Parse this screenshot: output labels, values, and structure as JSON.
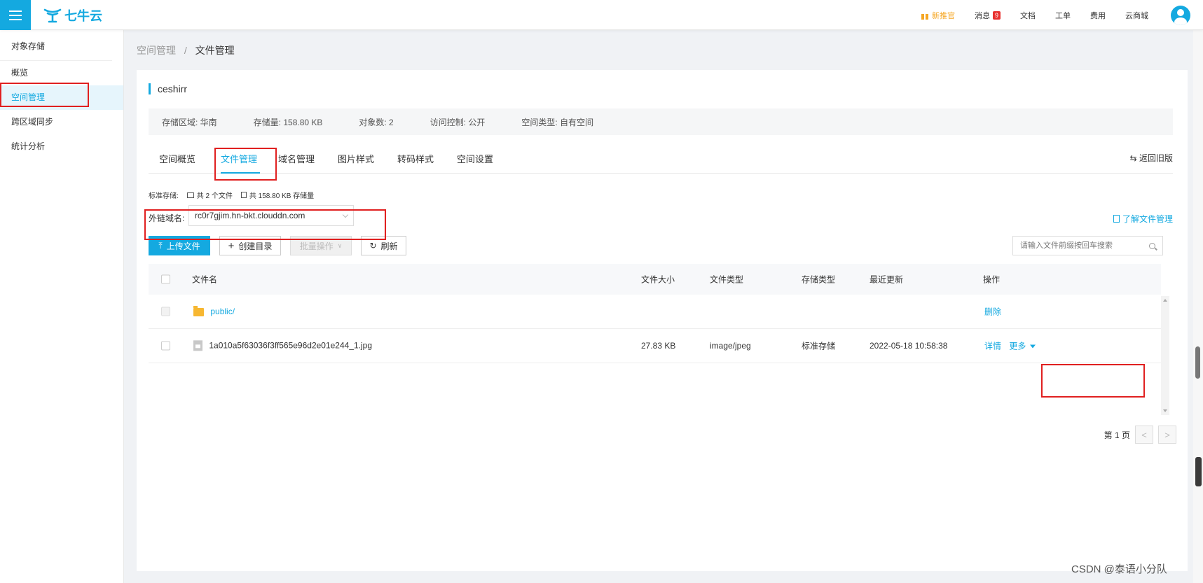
{
  "topbar": {
    "logo_text": "七牛云",
    "nav": {
      "promo": "新推官",
      "messages": "消息",
      "message_count": "9",
      "docs": "文档",
      "tickets": "工单",
      "billing": "费用",
      "store": "云商城"
    }
  },
  "sidebar": {
    "section": "对象存储",
    "items": [
      {
        "label": "概览"
      },
      {
        "label": "空间管理"
      },
      {
        "label": "跨区域同步"
      },
      {
        "label": "统计分析"
      }
    ]
  },
  "breadcrumb": {
    "parent": "空间管理",
    "sep": "/",
    "current": "文件管理"
  },
  "bucket": {
    "name": "ceshirr",
    "info": {
      "region": "存储区域:  华南",
      "storage": "存储量:  158.80 KB",
      "objects": "对象数:  2",
      "access": "访问控制:  公开",
      "type": "空间类型:  自有空间"
    }
  },
  "tabs": [
    "空间概览",
    "文件管理",
    "域名管理",
    "图片样式",
    "转码样式",
    "空间设置"
  ],
  "back_old": "返回旧版",
  "storage_summary": {
    "label": "标准存储:",
    "files": "共 2 个文件",
    "size": "共 158.80 KB 存储量"
  },
  "domain": {
    "label": "外链域名:",
    "value": "rc0r7gjim.hn-bkt.clouddn.com",
    "learn_link": "了解文件管理"
  },
  "toolbar": {
    "upload": "上传文件",
    "create_dir": "创建目录",
    "batch": "批量操作",
    "refresh": "刷新",
    "search_placeholder": "请输入文件前缀按回车搜索"
  },
  "table": {
    "headers": {
      "name": "文件名",
      "size": "文件大小",
      "type": "文件类型",
      "storage": "存储类型",
      "updated": "最近更新",
      "actions": "操作"
    },
    "rows": [
      {
        "name": "public/",
        "size": "",
        "type": "",
        "storage": "",
        "updated": "",
        "action1": "删除",
        "action2": ""
      },
      {
        "name": "1a010a5f63036f3ff565e96d2e01e244_1.jpg",
        "size": "27.83 KB",
        "type": "image/jpeg",
        "storage": "标准存储",
        "updated": "2022-05-18 10:58:38",
        "action1": "详情",
        "action2": "更多"
      }
    ]
  },
  "pager": {
    "label": "第 1 页",
    "prev": "<",
    "next": ">"
  },
  "watermark": "CSDN @泰语小分队",
  "colors": {
    "accent": "#14a9e0",
    "highlight": "#e02020",
    "promo": "#f5a623"
  }
}
